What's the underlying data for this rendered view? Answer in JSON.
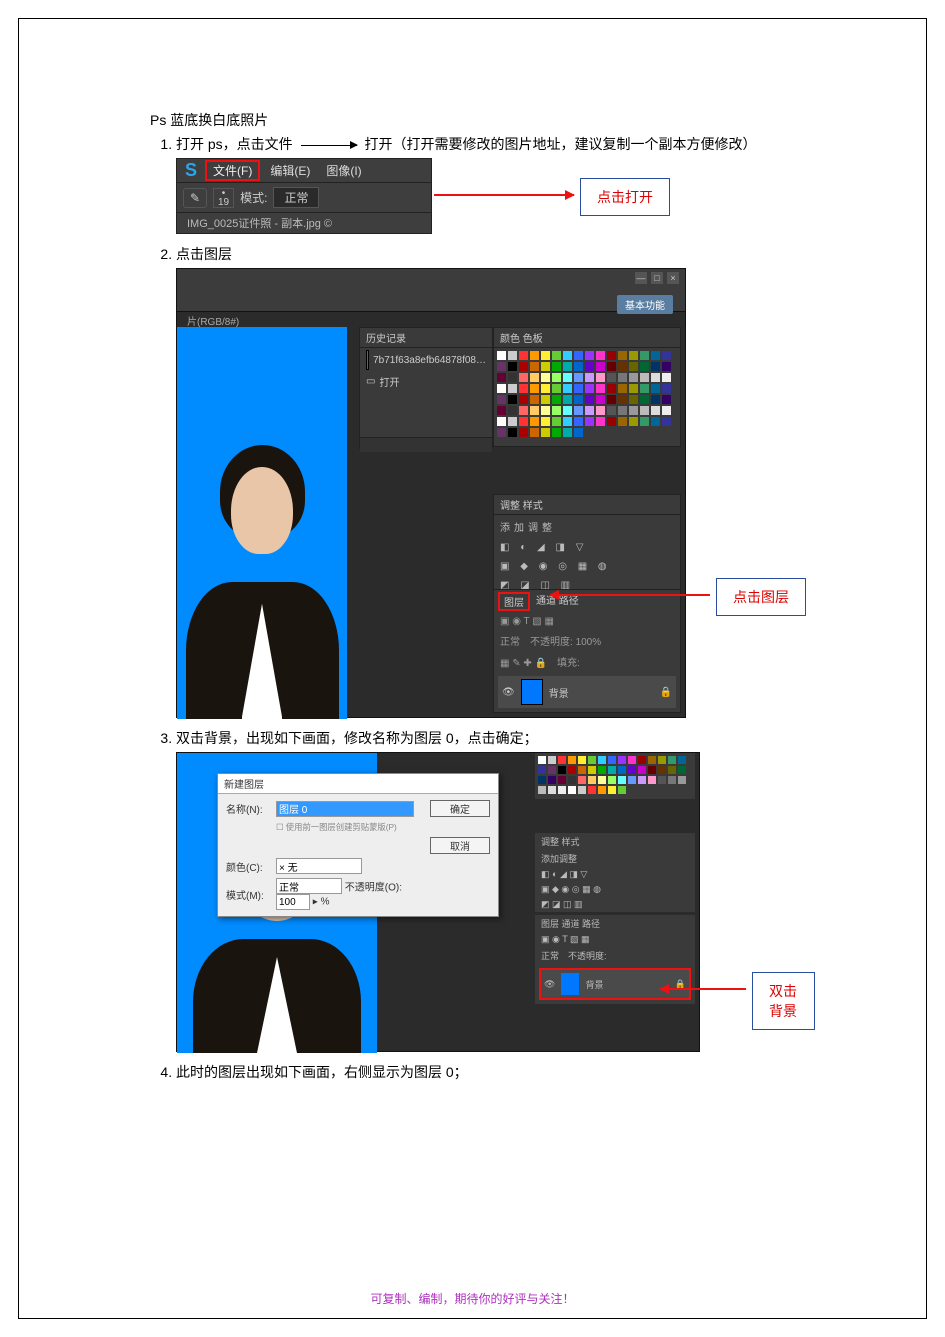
{
  "doc_title": "Ps 蓝底换白底照片",
  "steps": {
    "s1a": "打开 ps，点击文件",
    "s1b": "打开（打开需要修改的图片地址，建议复制一个副本方便修改）",
    "s2": "点击图层",
    "s3": "双击背景，出现如下画面，修改名称为图层 0，点击确定；",
    "s4": "此时的图层出现如下画面，右侧显示为图层 0；"
  },
  "callouts": {
    "c1": "点击打开",
    "c2": "点击图层",
    "c3": "双击背景"
  },
  "fig1": {
    "logo": "S",
    "menu_file": "文件(F)",
    "menu_edit": "编辑(E)",
    "menu_image": "图像(I)",
    "size": "19",
    "mode_label": "模式:",
    "mode_value": "正常",
    "tab": "IMG_0025证件照 - 副本.jpg ©"
  },
  "fig2": {
    "btn": "基本功能",
    "tab": "片(RGB/8#)",
    "history_title": "历史记录",
    "history_file": "7b71f63a8efb64878f08…",
    "history_open": "打开",
    "swatches_tabs": "颜色   色板",
    "adjust_tab": "调整   样式",
    "adjust_sub": "添加调整",
    "layers_tab": "图层",
    "layers_other": "通道   路径",
    "blend_mode": "正常",
    "opacity_label": "不透明度:",
    "opacity": "100%",
    "fill_label": "填充:",
    "layer_name": "背景"
  },
  "fig3": {
    "dialog_title": "新建图层",
    "name_label": "名称(N):",
    "name_value": "图层 0",
    "clip_label": "使用前一图层创建剪贴蒙版(P)",
    "color_label": "颜色(C):",
    "color_value": "× 无",
    "mode_label": "模式(M):",
    "mode_value": "正常",
    "opacity_label": "不透明度(O):",
    "opacity_value": "100",
    "opacity_unit": "%",
    "ok": "确定",
    "cancel": "取消",
    "adjust_tab": "调整   样式",
    "adjust_sub": "添加调整",
    "layers_tab": "图层   通道   路径",
    "blend": "正常",
    "opacity_panel": "不透明度:",
    "layer_name": "背景"
  },
  "footer": "可复制、编制，期待你的好评与关注！",
  "swatch_colors": [
    "#fff",
    "#ccc",
    "#f33",
    "#f90",
    "#fe3",
    "#6c3",
    "#3cf",
    "#36f",
    "#93f",
    "#f3c",
    "#900",
    "#960",
    "#990",
    "#396",
    "#069",
    "#339",
    "#636",
    "#000",
    "#a00",
    "#c60",
    "#cc0",
    "#0a0",
    "#0aa",
    "#06c",
    "#60c",
    "#c0c",
    "#600",
    "#630",
    "#660",
    "#063",
    "#036",
    "#306",
    "#603",
    "#333",
    "#f66",
    "#fc6",
    "#ff9",
    "#9f6",
    "#6ff",
    "#69f",
    "#c9f",
    "#f9c",
    "#555",
    "#777",
    "#999",
    "#bbb",
    "#ddd",
    "#eee"
  ]
}
